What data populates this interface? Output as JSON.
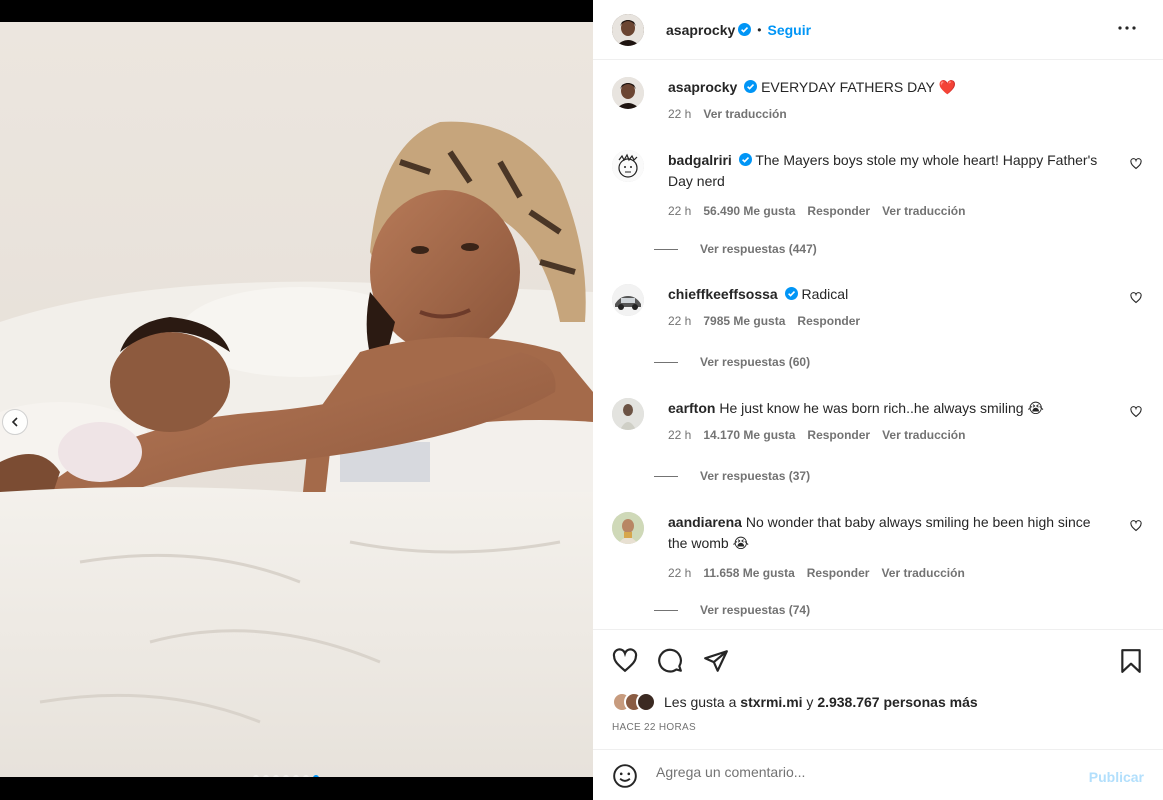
{
  "post": {
    "author": "asaprocky",
    "follow_label": "Seguir",
    "separator": "•",
    "caption": "EVERYDAY FATHERS DAY",
    "caption_emoji": "❤️",
    "caption_time": "22 h",
    "caption_translate": "Ver traducción"
  },
  "comments": [
    {
      "username": "badgalriri",
      "verified": true,
      "text": "The Mayers boys stole my whole heart! Happy Father's Day nerd",
      "time": "22 h",
      "likes": "56.490 Me gusta",
      "reply": "Responder",
      "translate": "Ver traducción",
      "replies_label": "Ver respuestas (447)"
    },
    {
      "username": "chieffkeeffsossa",
      "verified": true,
      "text": "Radical",
      "time": "22 h",
      "likes": "7985 Me gusta",
      "reply": "Responder",
      "replies_label": "Ver respuestas (60)"
    },
    {
      "username": "earfton",
      "verified": false,
      "text": "He just know he was born rich..he always smiling 😭",
      "time": "22 h",
      "likes": "14.170 Me gusta",
      "reply": "Responder",
      "translate": "Ver traducción",
      "replies_label": "Ver respuestas (37)"
    },
    {
      "username": "aandiarena",
      "verified": false,
      "text": "No wonder that baby always smiling he been high since the womb 😭",
      "time": "22 h",
      "likes": "11.658 Me gusta",
      "reply": "Responder",
      "translate": "Ver traducción",
      "replies_label": "Ver respuestas (74)"
    }
  ],
  "likes_summary": {
    "prefix": "Les gusta a",
    "user": "stxrmi.mi",
    "conj": "y",
    "others": "2.938.767 personas más"
  },
  "time_ago": "HACE 22 HORAS",
  "composer": {
    "placeholder": "Agrega un comentario...",
    "publish": "Publicar"
  },
  "carousel": {
    "slide_count": 7,
    "active_index": 6
  },
  "colors": {
    "accent": "#0095f6",
    "heart": "#ed4956",
    "muted": "#737373"
  }
}
